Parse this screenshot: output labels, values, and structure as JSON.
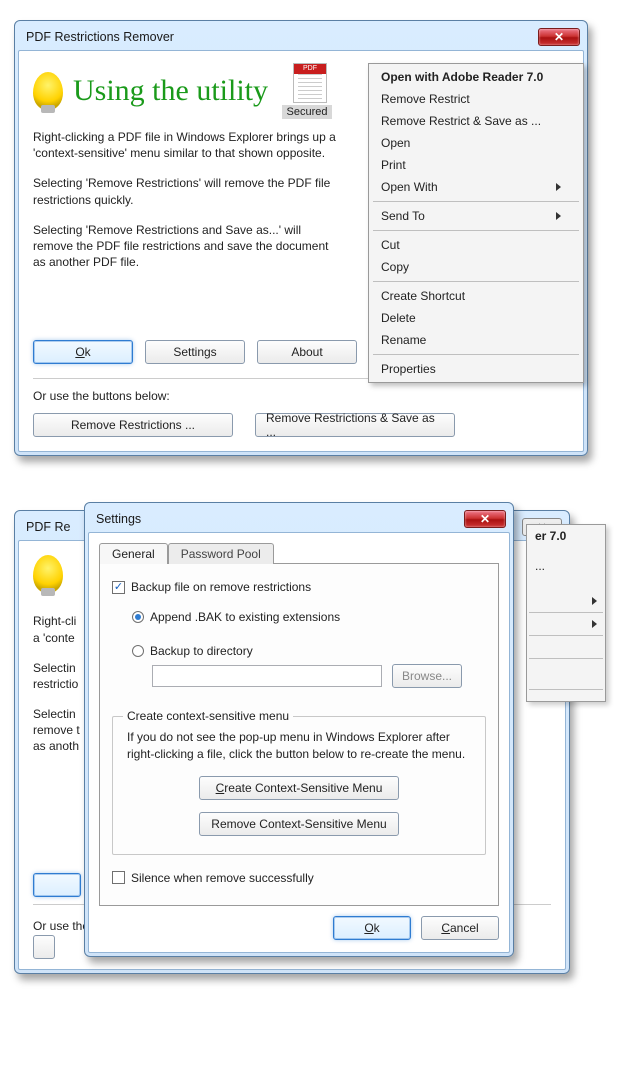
{
  "win1": {
    "title": "PDF Restrictions Remover",
    "heading": "Using the utility",
    "secured": "Secured",
    "p1": "Right-clicking a PDF file in Windows Explorer brings up a 'context-sensitive' menu similar to that shown opposite.",
    "p2": "Selecting 'Remove Restrictions' will remove the PDF file restrictions quickly.",
    "p3": "Selecting 'Remove Restrictions and Save as...' will remove the PDF file restrictions and save the document as another PDF file.",
    "ok": "Ok",
    "settings": "Settings",
    "about": "About",
    "or_use": "Or use the buttons below:",
    "rr": "Remove Restrictions ...",
    "rrsa": "Remove Restrictions & Save as ..."
  },
  "ctx": {
    "open_adobe": "Open with Adobe Reader 7.0",
    "remove_restrict": "Remove Restrict",
    "remove_restrict_save": "Remove Restrict & Save as ...",
    "open": "Open",
    "print": "Print",
    "open_with": "Open With",
    "send_to": "Send To",
    "cut": "Cut",
    "copy": "Copy",
    "create_shortcut": "Create Shortcut",
    "delete": "Delete",
    "rename": "Rename",
    "properties": "Properties"
  },
  "under": {
    "title_frag": "PDF Re",
    "p1a": "Right-cli",
    "p1b": "a 'conte",
    "p2a": "Selectin",
    "p2b": "restrictio",
    "p3a": "Selectin",
    "p3b": "remove t",
    "p3c": "as anoth",
    "or_frag": "Or use the",
    "ctx_frag1": "er 7.0",
    "ctx_frag2": "..."
  },
  "settings": {
    "title": "Settings",
    "tab_general": "General",
    "tab_pwpool": "Password Pool",
    "backup_chk": "Backup file on remove restrictions",
    "append_bak": "Append .BAK to existing extensions",
    "backup_dir": "Backup to directory",
    "browse": "Browse...",
    "legend": "Create context-sensitive menu",
    "help_text": "If you do not see the pop-up menu in Windows Explorer after right-clicking a file, click the button below to re-create the menu.",
    "create_btn": "Create Context-Sensitive Menu",
    "remove_btn": "Remove Context-Sensitive Menu",
    "silence": "Silence when remove successfully",
    "ok": "Ok",
    "cancel": "Cancel"
  }
}
